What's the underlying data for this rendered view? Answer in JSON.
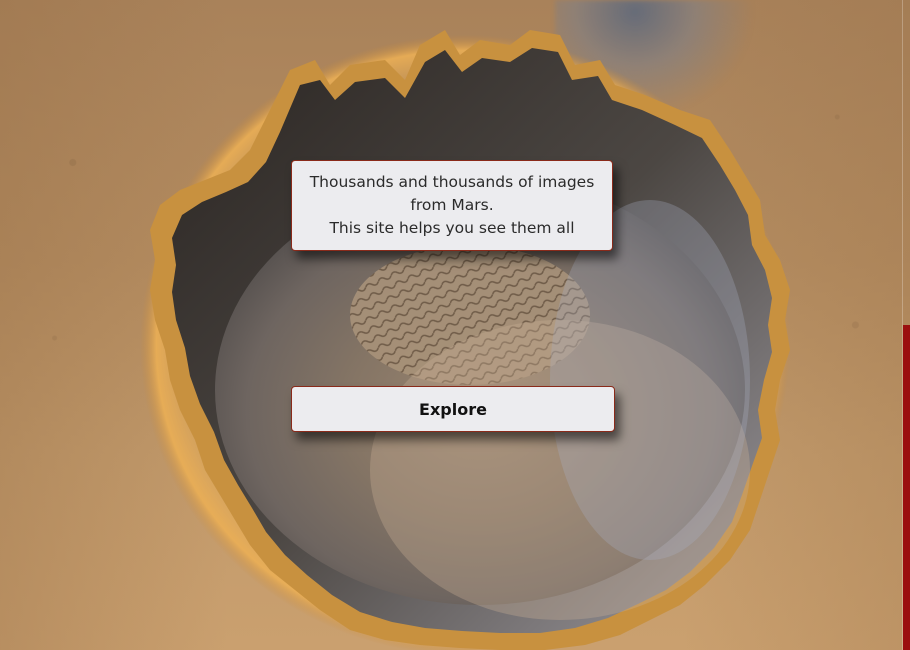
{
  "hero": {
    "line1": "Thousands and thousands of images",
    "line2": "from Mars.",
    "line3": "This site helps you see them all"
  },
  "explore": {
    "label": "Explore"
  },
  "colors": {
    "card_bg": "#ececef",
    "card_border": "#8a2a1a",
    "scroll_indicator": "#9b0f0f",
    "surface": "#b48c60"
  },
  "icons": {
    "background": "mars-crater-image"
  }
}
